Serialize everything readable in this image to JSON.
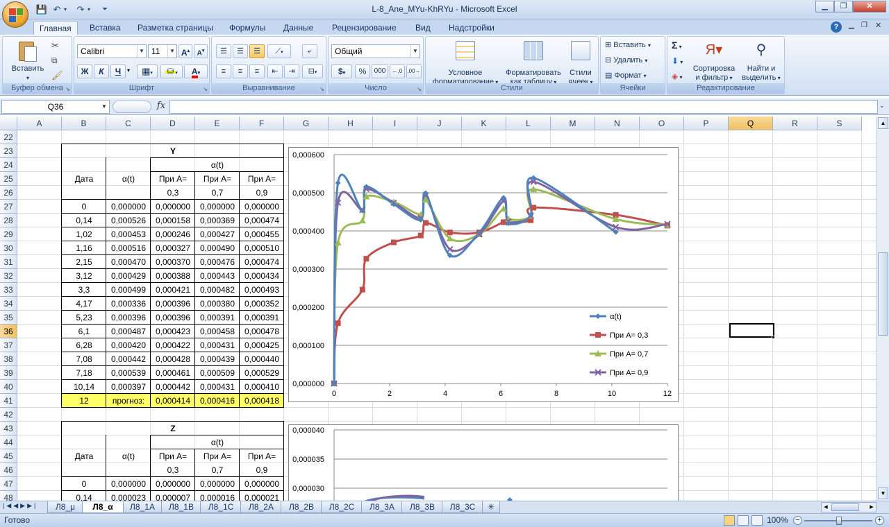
{
  "app": {
    "title": "L-8_Ane_MYu-KhRYu - Microsoft Excel"
  },
  "ribbon": {
    "tabs": [
      "Главная",
      "Вставка",
      "Разметка страницы",
      "Формулы",
      "Данные",
      "Рецензирование",
      "Вид",
      "Надстройки"
    ],
    "groups": {
      "clipboard": {
        "label": "Буфер обмена",
        "paste": "Вставить"
      },
      "font": {
        "label": "Шрифт",
        "name": "Calibri",
        "size": "11",
        "bold": "Ж",
        "italic": "К",
        "underline": "Ч"
      },
      "alignment": {
        "label": "Выравнивание"
      },
      "number": {
        "label": "Число",
        "format": "Общий",
        "currency": "$",
        "percent": "%",
        "thousands": "000"
      },
      "styles": {
        "label": "Стили",
        "cond_format_1": "Условное",
        "cond_format_2": "форматирование",
        "as_table_1": "Форматировать",
        "as_table_2": "как таблицу",
        "cell_styles_1": "Стили",
        "cell_styles_2": "ячеек"
      },
      "cells": {
        "label": "Ячейки",
        "insert": "Вставить",
        "delete": "Удалить",
        "format": "Формат"
      },
      "editing": {
        "label": "Редактирование",
        "sum": "Σ",
        "sort_1": "Сортировка",
        "sort_2": "и фильтр",
        "find_1": "Найти и",
        "find_2": "выделить"
      }
    }
  },
  "formula_bar": {
    "name_box": "Q36",
    "fx": "fx",
    "value": ""
  },
  "grid": {
    "columns": [
      "A",
      "B",
      "C",
      "D",
      "E",
      "F",
      "G",
      "H",
      "I",
      "J",
      "K",
      "L",
      "M",
      "N",
      "O",
      "P",
      "Q",
      "R",
      "S"
    ],
    "rows": [
      "22",
      "23",
      "24",
      "25",
      "26",
      "27",
      "28",
      "29",
      "30",
      "31",
      "32",
      "33",
      "34",
      "35",
      "36",
      "37",
      "38",
      "39",
      "40",
      "41",
      "42",
      "43",
      "44",
      "45",
      "46",
      "47",
      "48"
    ],
    "selected_col": "Q",
    "selected_row": "36"
  },
  "table_y": {
    "title": "Y",
    "hdr_date": "Дата",
    "hdr_alpha": "α(t)",
    "hdr_alpha_group": "α(t)",
    "hdr_a_label": "При A=",
    "a_values": [
      "0,3",
      "0,7",
      "0,9"
    ],
    "rows": [
      [
        "0",
        "0,000000",
        "0,000000",
        "0,000000",
        "0,000000"
      ],
      [
        "0,14",
        "0,000526",
        "0,000158",
        "0,000369",
        "0,000474"
      ],
      [
        "1,02",
        "0,000453",
        "0,000246",
        "0,000427",
        "0,000455"
      ],
      [
        "1,16",
        "0,000516",
        "0,000327",
        "0,000490",
        "0,000510"
      ],
      [
        "2,15",
        "0,000470",
        "0,000370",
        "0,000476",
        "0,000474"
      ],
      [
        "3,12",
        "0,000429",
        "0,000388",
        "0,000443",
        "0,000434"
      ],
      [
        "3,3",
        "0,000499",
        "0,000421",
        "0,000482",
        "0,000493"
      ],
      [
        "4,17",
        "0,000336",
        "0,000396",
        "0,000380",
        "0,000352"
      ],
      [
        "5,23",
        "0,000396",
        "0,000396",
        "0,000391",
        "0,000391"
      ],
      [
        "6,1",
        "0,000487",
        "0,000423",
        "0,000458",
        "0,000478"
      ],
      [
        "6,28",
        "0,000420",
        "0,000422",
        "0,000431",
        "0,000425"
      ],
      [
        "7,08",
        "0,000442",
        "0,000428",
        "0,000439",
        "0,000440"
      ],
      [
        "7,18",
        "0,000539",
        "0,000461",
        "0,000509",
        "0,000529"
      ],
      [
        "10,14",
        "0,000397",
        "0,000442",
        "0,000431",
        "0,000410"
      ]
    ],
    "forecast": {
      "date": "12",
      "label": "прогноз:",
      "values": [
        "0,000414",
        "0,000416",
        "0,000418"
      ]
    }
  },
  "table_z": {
    "title": "Z",
    "hdr_date": "Дата",
    "hdr_alpha": "α(t)",
    "hdr_alpha_group": "α(t)",
    "hdr_a_label": "При A=",
    "a_values": [
      "0,3",
      "0,7",
      "0,9"
    ],
    "rows": [
      [
        "0",
        "0,000000",
        "0,000000",
        "0,000000",
        "0,000000"
      ],
      [
        "0,14",
        "0,000023",
        "0,000007",
        "0,000016",
        "0,000021"
      ]
    ]
  },
  "chart_data": [
    {
      "type": "line",
      "x": [
        0,
        0.14,
        1.02,
        1.16,
        2.15,
        3.12,
        3.3,
        4.17,
        5.23,
        6.1,
        6.28,
        7.08,
        7.18,
        10.14,
        12
      ],
      "series": [
        {
          "name": "α(t)",
          "color": "#4f81bd",
          "values": [
            0,
            0.000526,
            0.000453,
            0.000516,
            0.00047,
            0.000429,
            0.000499,
            0.000336,
            0.000396,
            0.000487,
            0.00042,
            0.000442,
            0.000539,
            0.000397,
            null
          ]
        },
        {
          "name": "При A= 0,3",
          "color": "#c0504d",
          "values": [
            0,
            0.000158,
            0.000246,
            0.000327,
            0.00037,
            0.000388,
            0.000421,
            0.000396,
            0.000396,
            0.000423,
            0.000422,
            0.000428,
            0.000461,
            0.000442,
            0.000414
          ]
        },
        {
          "name": "При A= 0,7",
          "color": "#9bbb59",
          "values": [
            0,
            0.000369,
            0.000427,
            0.00049,
            0.000476,
            0.000443,
            0.000482,
            0.00038,
            0.000391,
            0.000458,
            0.000431,
            0.000439,
            0.000509,
            0.000431,
            0.000416
          ]
        },
        {
          "name": "При A= 0,9",
          "color": "#8064a2",
          "values": [
            0,
            0.000474,
            0.000455,
            0.00051,
            0.000474,
            0.000434,
            0.000493,
            0.000352,
            0.000391,
            0.000478,
            0.000425,
            0.00044,
            0.000529,
            0.00041,
            0.000418
          ]
        }
      ],
      "xlim": [
        0,
        12
      ],
      "ylim": [
        0,
        0.0006
      ],
      "xticks": [
        "0",
        "2",
        "4",
        "6",
        "8",
        "10",
        "12"
      ],
      "yticks": [
        "0,000000",
        "0,000100",
        "0,000200",
        "0,000300",
        "0,000400",
        "0,000500",
        "0,000600"
      ],
      "legend": "right",
      "grid": "horizontal"
    },
    {
      "type": "line",
      "yticks": [
        "0,000040",
        "0,000035",
        "0,000030"
      ],
      "grid": "horizontal"
    }
  ],
  "sheets": {
    "tabs": [
      "Л8_μ",
      "Л8_α",
      "Л8_1А",
      "Л8_1В",
      "Л8_1С",
      "Л8_2А",
      "Л8_2В",
      "Л8_2С",
      "Л8_3А",
      "Л8_3В",
      "Л8_3С"
    ],
    "active": "Л8_α"
  },
  "status": {
    "ready": "Готово",
    "zoom": "100%"
  }
}
